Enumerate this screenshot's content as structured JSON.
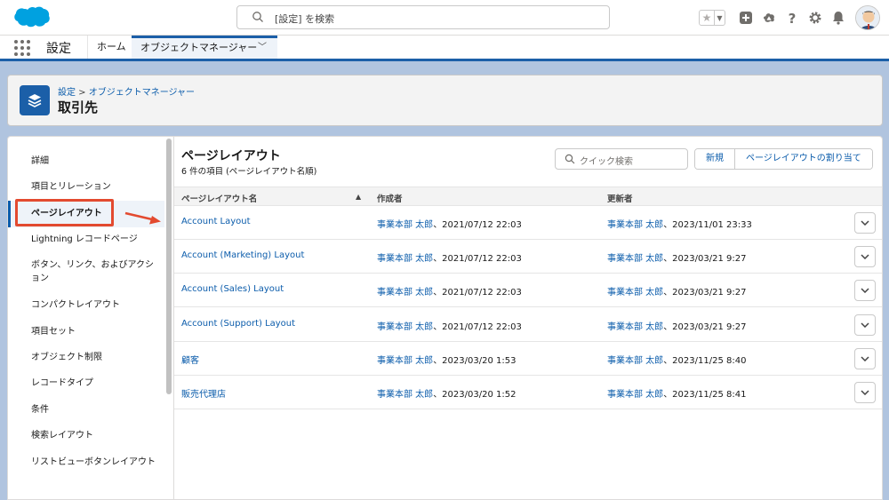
{
  "header": {
    "search_placeholder": "[設定] を検索",
    "icons": [
      "favorites-star-icon",
      "add-icon",
      "trailhead-icon",
      "help-icon",
      "setup-gear-icon",
      "notification-bell-icon",
      "user-avatar"
    ]
  },
  "nav": {
    "app_name": "設定",
    "home_label": "ホーム",
    "object_manager_label": "オブジェクトマネージャー"
  },
  "page_header": {
    "breadcrumb_setup": "設定",
    "breadcrumb_sep": " > ",
    "breadcrumb_om": "オブジェクトマネージャー",
    "title": "取引先"
  },
  "sidebar": {
    "items": [
      {
        "label": "詳細"
      },
      {
        "label": "項目とリレーション"
      },
      {
        "label": "ページレイアウト",
        "active": true
      },
      {
        "label": "Lightning レコードページ"
      },
      {
        "label": "ボタン、リンク、およびアクション"
      },
      {
        "label": "コンパクトレイアウト"
      },
      {
        "label": "項目セット"
      },
      {
        "label": "オブジェクト制限"
      },
      {
        "label": "レコードタイプ"
      },
      {
        "label": "条件"
      },
      {
        "label": "検索レイアウト"
      },
      {
        "label": "リストビューボタンレイアウト"
      }
    ]
  },
  "main": {
    "title": "ページレイアウト",
    "subtitle": "6 件の項目 (ページレイアウト名順)",
    "quick_search_placeholder": "クイック検索",
    "new_button": "新規",
    "assign_button": "ページレイアウトの割り当て",
    "columns": {
      "name": "ページレイアウト名",
      "created_by": "作成者",
      "modified_by": "更新者"
    },
    "rows": [
      {
        "name": "Account Layout",
        "creator": "事業本部 太郎",
        "created": "、2021/07/12 22:03",
        "modifier": "事業本部 太郎",
        "modified": "、2023/11/01 23:33"
      },
      {
        "name": "Account (Marketing) Layout",
        "creator": "事業本部 太郎",
        "created": "、2021/07/12 22:03",
        "modifier": "事業本部 太郎",
        "modified": "、2023/03/21 9:27"
      },
      {
        "name": "Account (Sales) Layout",
        "creator": "事業本部 太郎",
        "created": "、2021/07/12 22:03",
        "modifier": "事業本部 太郎",
        "modified": "、2023/03/21 9:27"
      },
      {
        "name": "Account (Support) Layout",
        "creator": "事業本部 太郎",
        "created": "、2021/07/12 22:03",
        "modifier": "事業本部 太郎",
        "modified": "、2023/03/21 9:27"
      },
      {
        "name": "顧客",
        "creator": "事業本部 太郎",
        "created": "、2023/03/20 1:53",
        "modifier": "事業本部 太郎",
        "modified": "、2023/11/25 8:40"
      },
      {
        "name": "販売代理店",
        "creator": "事業本部 太郎",
        "created": "、2023/03/20 1:52",
        "modifier": "事業本部 太郎",
        "modified": "、2023/11/25 8:41"
      }
    ]
  },
  "colors": {
    "brand_blue": "#1b5fa8",
    "link_blue": "#0b5cab",
    "salesforce_cloud": "#00a1e0",
    "annotation_red": "#e34a2f"
  }
}
